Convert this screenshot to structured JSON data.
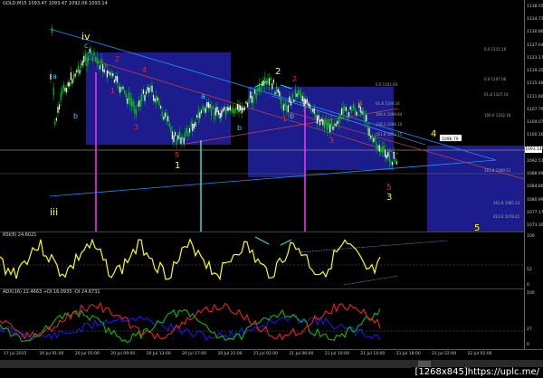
{
  "window": {
    "title": "GOLD,M15  1093.47 1093.47 1092.06 1093.14",
    "symbol": "GOLD",
    "timeframe": "M15"
  },
  "price_axis": {
    "labels": [
      "1138.55",
      "1134.73",
      "1130.86",
      "1127.04",
      "1123.17",
      "1119.35",
      "1115.48",
      "1111.66",
      "1107.79",
      "1104.07",
      "1100.16",
      "1096.37",
      "1092.51",
      "1088.69",
      "1084.86",
      "1080.99",
      "1077.17",
      "1073.30"
    ],
    "current_price": "1093.14",
    "label_rect": "1096.79"
  },
  "fib_labels": [
    "0.0 1115.16",
    "61.8 1107.14",
    "100.0 1102.18",
    "0.0 1101.64",
    "61.8 1104.16",
    "100.0 1099.64",
    "138.2 1096.10",
    "161.8 1093.75",
    "0.0 1107.06",
    "161.8 1089.51",
    "261.8 1085.13",
    "423.6 1078.41"
  ],
  "wave_labels": {
    "iv": "iv",
    "iii": "iii",
    "c": "c",
    "a": "a",
    "b": "b",
    "w1": "1",
    "w2": "2",
    "w3": "3",
    "w4": "4",
    "w5": "5"
  },
  "rsi": {
    "title": "RSI(8) 24.6021",
    "levels": [
      "100",
      "52",
      "0"
    ]
  },
  "adx": {
    "title": "ADX(16) 22.4663 +DI 16.0935 -DI 24.6731",
    "levels": [
      "100",
      "27",
      "0"
    ]
  },
  "time_axis": [
    "17 Jul 2015",
    "20 Jul 01:00",
    "20 Jul 05:00",
    "20 Jul 09:00",
    "20 Jul 13:00",
    "20 Jul 17:00",
    "20 Jul 21:00",
    "21 Jul 02:00",
    "21 Jul 06:00",
    "21 Jul 10:00",
    "21 Jul 14:00",
    "21 Jul 18:00",
    "21 Jul 22:00",
    "22 Jul 02:00"
  ],
  "colors": {
    "up_candle": "#00cc00",
    "box_fill": "#1c1c8c",
    "rsi_line": "#ffff00",
    "adx_plus": "#00cc00",
    "adx_minus": "#ff2020",
    "adx_main": "#1a1aff",
    "trendline": "#1e90ff",
    "magenta_line": "#ff33ff",
    "cyan_line": "#33dddd"
  },
  "watermark": "[1268x845]https://uplc.me/"
}
